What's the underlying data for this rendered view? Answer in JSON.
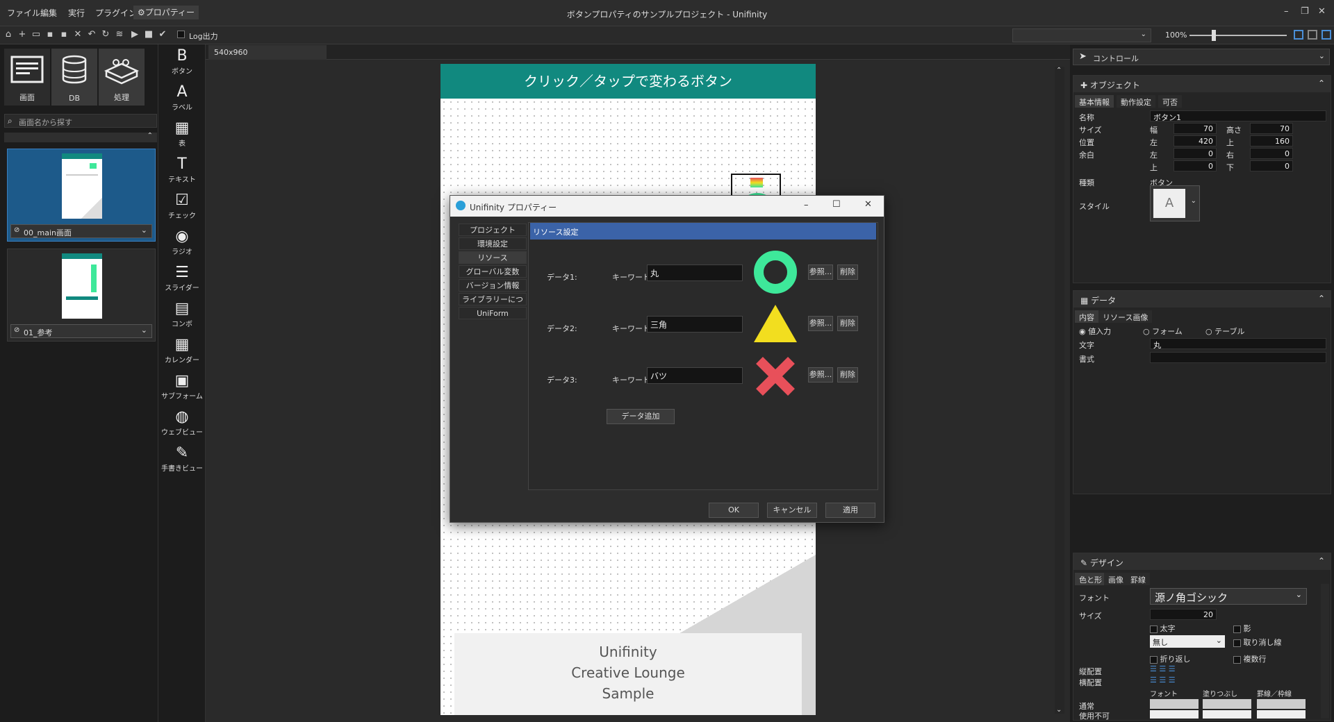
{
  "menu": [
    "ファイル",
    "編集",
    "実行",
    "プラグイン",
    "⚙プロパティー"
  ],
  "window_title": "ボタンプロパティのサンプルプロジェクト - Unifinity",
  "toolbar": {
    "log_label": "Log出力",
    "zoom": "100%"
  },
  "left_tabs": [
    {
      "label": "画面",
      "icon": "screen-icon"
    },
    {
      "label": "DB",
      "icon": "database-icon"
    },
    {
      "label": "処理",
      "icon": "blocks-icon"
    }
  ],
  "search_placeholder": "画面名から探す",
  "screens": [
    {
      "name": "00_main画面"
    },
    {
      "name": "01_参考"
    }
  ],
  "palette": [
    {
      "label": "ボタン",
      "icon": "B"
    },
    {
      "label": "ラベル",
      "icon": "A"
    },
    {
      "label": "表",
      "icon": "▦"
    },
    {
      "label": "テキスト",
      "icon": "T"
    },
    {
      "label": "チェック",
      "icon": "☑"
    },
    {
      "label": "ラジオ",
      "icon": "◉"
    },
    {
      "label": "スライダー",
      "icon": "☰"
    },
    {
      "label": "コンボ",
      "icon": "▤"
    },
    {
      "label": "カレンダー",
      "icon": "▦"
    },
    {
      "label": "サブフォーム",
      "icon": "▣"
    },
    {
      "label": "ウェブビュー",
      "icon": "◍"
    },
    {
      "label": "手書きビュー",
      "icon": "✎"
    }
  ],
  "canvas": {
    "size_tab": "540x960",
    "header": "クリック／タップで変わるボタン",
    "header_color": "#11897f",
    "footer_lines": [
      "Unifinity",
      "Creative Lounge",
      "Sample"
    ]
  },
  "dialog": {
    "title": "Unifinity プロパティー",
    "nav": [
      "プロジェクト",
      "環境設定",
      "リソース",
      "グローバル変数",
      "バージョン情報",
      "ライブラリーについて",
      "UniForm"
    ],
    "nav_active": 2,
    "section": "リソース設定",
    "keyword_label": "キーワード:",
    "ref_label": "参照...",
    "delete_label": "削除",
    "rows": [
      {
        "label": "データ1:",
        "keyword": "丸",
        "shape": "circle-icon",
        "color": "#3ee89a"
      },
      {
        "label": "データ2:",
        "keyword": "三角",
        "shape": "triangle-icon",
        "color": "#f2de1f"
      },
      {
        "label": "データ3:",
        "keyword": "バツ",
        "shape": "cross-icon",
        "color": "#e8505a"
      }
    ],
    "add_label": "データ追加",
    "ok": "OK",
    "cancel": "キャンセル",
    "apply": "適用"
  },
  "right": {
    "control": "コントロール",
    "object": {
      "title": "オブジェクト",
      "tabs": [
        "基本情報",
        "動作設定",
        "可否"
      ],
      "name_label": "名称",
      "name": "ボタン1",
      "size_label": "サイズ",
      "width_label": "幅",
      "width": "70",
      "height_label": "高さ",
      "height": "70",
      "pos_label": "位置",
      "left_label": "左",
      "left": "420",
      "top_label": "上",
      "top": "160",
      "margin_label": "余白",
      "m_left_label": "左",
      "m_left": "0",
      "m_right_label": "右",
      "m_right": "0",
      "m_top_label": "上",
      "m_top": "0",
      "m_bottom_label": "下",
      "m_bottom": "0",
      "kind_label": "種類",
      "kind": "ボタン",
      "style_label": "スタイル",
      "style_preview": "A"
    },
    "data": {
      "title": "データ",
      "tabs": [
        "内容",
        "リソース画像"
      ],
      "radios": [
        "値入力",
        "フォーム",
        "テーブル"
      ],
      "text_label": "文字",
      "text": "丸",
      "format_label": "書式"
    },
    "design": {
      "title": "デザイン",
      "tabs": [
        "色と形",
        "画像",
        "罫線"
      ],
      "font_label": "フォント",
      "font": "源ノ角ゴシック",
      "size_label": "サイズ",
      "size": "20",
      "bold": "太字",
      "shadow": "影",
      "none": "無し",
      "strike": "取り消し線",
      "wrap": "折り返し",
      "multiline": "複数行",
      "valign": "縦配置",
      "halign": "横配置",
      "col_font": "フォント",
      "col_fill": "塗りつぶし",
      "col_border": "罫線／枠線",
      "normal": "通常",
      "disabled": "使用不可"
    }
  }
}
